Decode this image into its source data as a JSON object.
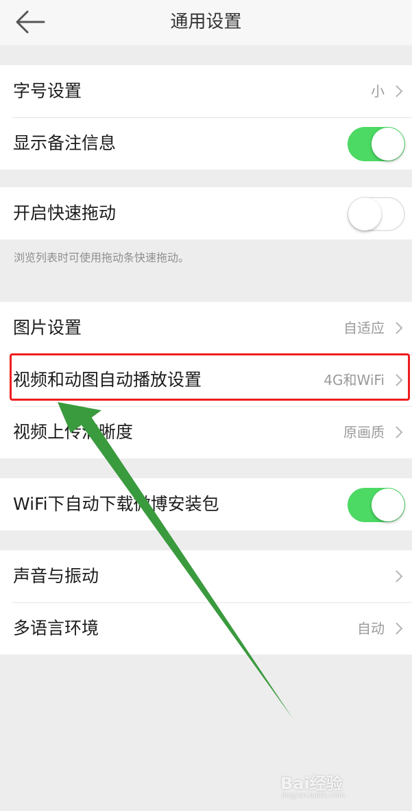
{
  "header": {
    "title": "通用设置"
  },
  "group1": {
    "font_size": {
      "label": "字号设置",
      "value": "小"
    },
    "show_remark": {
      "label": "显示备注信息",
      "toggle": true
    }
  },
  "group2": {
    "fast_drag": {
      "label": "开启快速拖动",
      "toggle": false
    },
    "hint": "浏览列表时可使用拖动条快速拖动。"
  },
  "group3": {
    "image": {
      "label": "图片设置",
      "value": "自适应"
    },
    "autoplay": {
      "label": "视频和动图自动播放设置",
      "value": "4G和WiFi"
    },
    "upload_quality": {
      "label": "视频上传清晰度",
      "value": "原画质"
    }
  },
  "group4": {
    "wifi_download": {
      "label": "WiFi下自动下载微博安装包",
      "toggle": true
    }
  },
  "group5": {
    "sound": {
      "label": "声音与振动",
      "value": ""
    },
    "language": {
      "label": "多语言环境",
      "value": "自动"
    }
  },
  "colors": {
    "toggle_on": "#4cd964",
    "highlight": "#ee1d1d",
    "arrow": "#3a9a3e"
  },
  "watermark": {
    "brand": "Bai经验",
    "url": "jingyan.baidu.com"
  }
}
